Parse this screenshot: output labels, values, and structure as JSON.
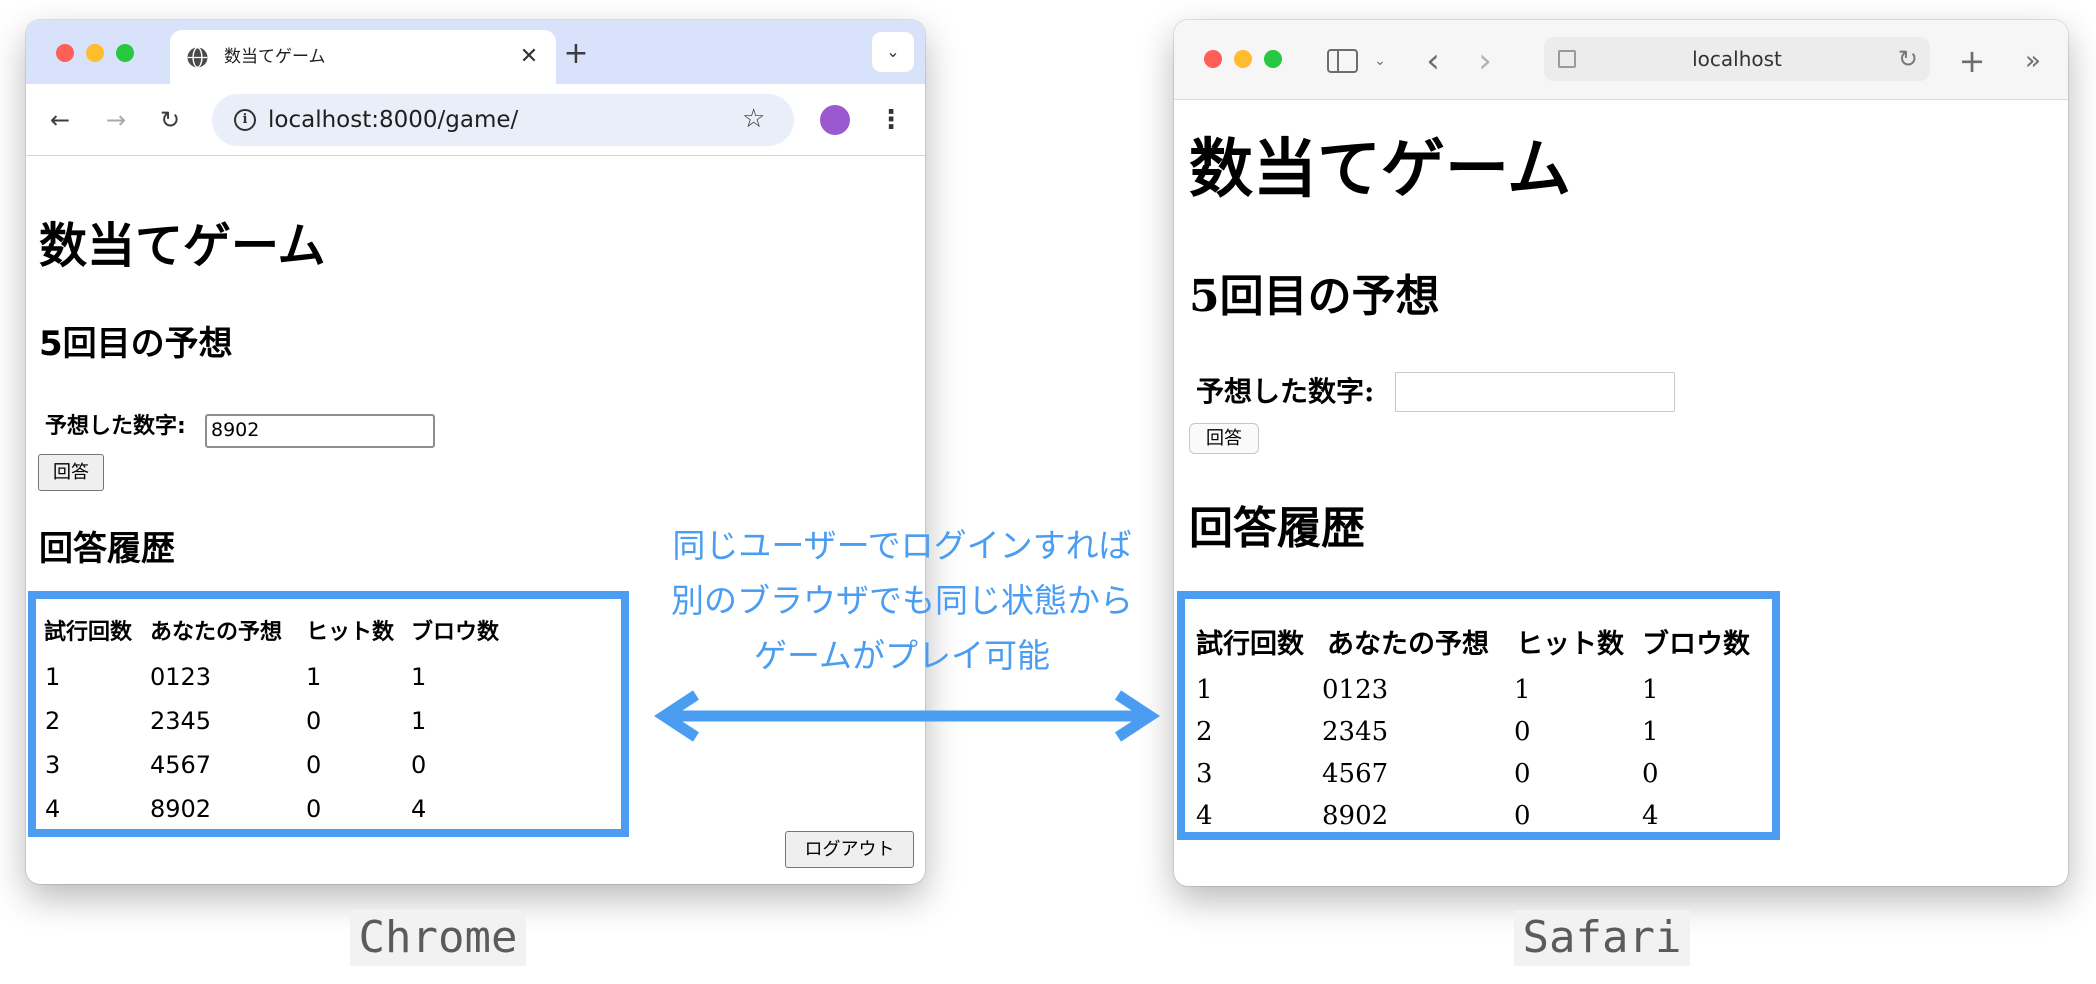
{
  "chrome": {
    "tab_title": "数当てゲーム",
    "url": "localhost:8000/game/",
    "page": {
      "heading": "数当てゲーム",
      "round_heading": "5回目の予想",
      "input_label": "予想した数字:",
      "input_value": "8902",
      "submit_label": "回答",
      "history_heading": "回答履歴",
      "logout_label": "ログアウト"
    }
  },
  "safari": {
    "address": "localhost",
    "page": {
      "heading": "数当てゲーム",
      "round_heading": "5回目の予想",
      "input_label": "予想した数字:",
      "input_value": "",
      "submit_label": "回答",
      "history_heading": "回答履歴"
    }
  },
  "history_table": {
    "headers": [
      "試行回数",
      "あなたの予想",
      "ヒット数",
      "ブロウ数"
    ],
    "rows": [
      [
        "1",
        "0123",
        "1",
        "1"
      ],
      [
        "2",
        "2345",
        "0",
        "1"
      ],
      [
        "3",
        "4567",
        "0",
        "0"
      ],
      [
        "4",
        "8902",
        "0",
        "4"
      ]
    ]
  },
  "annotation": {
    "lines": [
      "同じユーザーでログインすれば",
      "別のブラウザでも同じ状態から",
      "ゲームがプレイ可能"
    ]
  },
  "captions": {
    "left": "Chrome",
    "right": "Safari"
  },
  "colors": {
    "accent": "#4a9df0",
    "chrome_tabstrip": "#d8e2fa"
  }
}
